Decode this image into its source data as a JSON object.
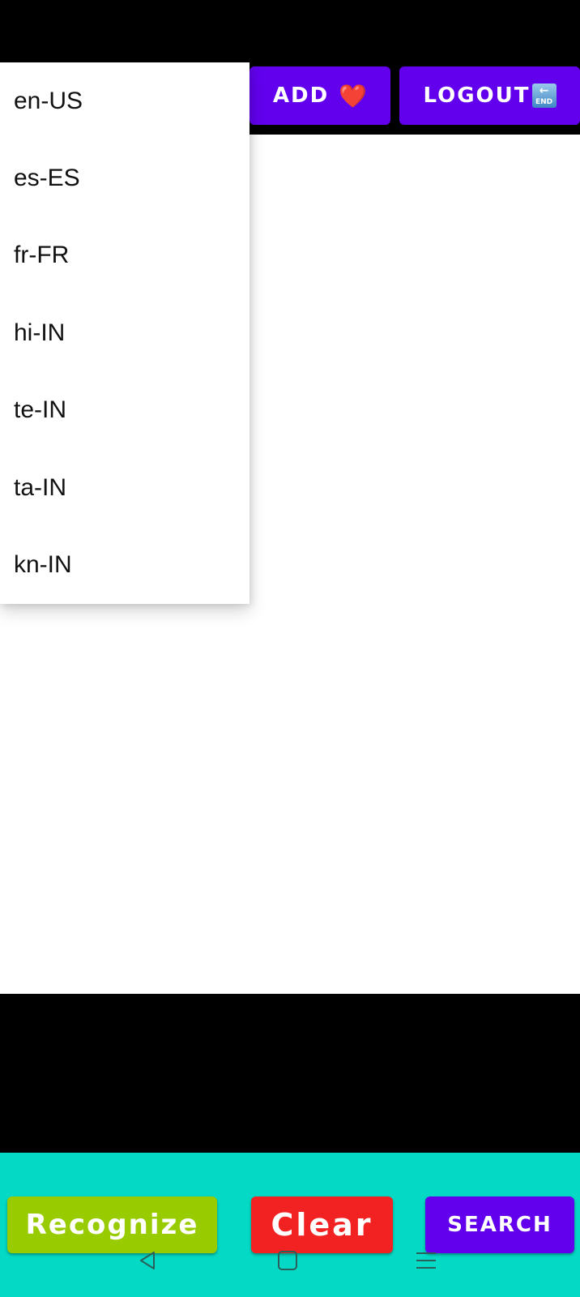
{
  "toolbar": {
    "add_label": "ADD",
    "add_emoji": "❤️",
    "logout_label": "LOGOUT",
    "logout_icon": "end-arrow-icon",
    "logout_icon_text": "END",
    "logout_icon_arrow": "←"
  },
  "dropdown": {
    "items": [
      {
        "label": "en-US"
      },
      {
        "label": "es-ES"
      },
      {
        "label": "fr-FR"
      },
      {
        "label": "hi-IN"
      },
      {
        "label": "te-IN"
      },
      {
        "label": "ta-IN"
      },
      {
        "label": "kn-IN"
      }
    ]
  },
  "bottom": {
    "recognize_label": "Recognize",
    "clear_label": "Clear",
    "search_label": "SEARCH"
  },
  "navbar": {
    "back_icon": "back-triangle-icon",
    "home_icon": "home-square-icon",
    "menu_icon": "menu-lines-icon"
  },
  "colors": {
    "primary": "#6200EE",
    "recognize": "#99CC00",
    "clear": "#F22222",
    "bottom_bar": "#03D9C5",
    "background": "#000000",
    "content": "#FFFFFF"
  }
}
